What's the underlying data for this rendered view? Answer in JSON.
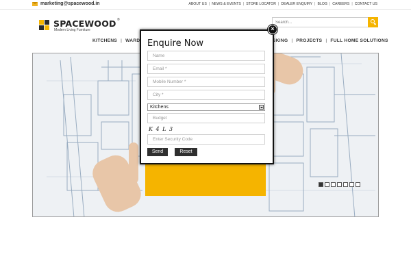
{
  "header": {
    "email": "marketing@spacewood.in",
    "links": [
      "ABOUT US",
      "NEWS & EVENTS",
      "STORE LOCATOR",
      "DEALER ENQUIRY",
      "BLOG",
      "CAREERS",
      "CONTACT US"
    ]
  },
  "logo": {
    "brand": "SPACEWOOD",
    "registered": "®",
    "tagline": "Modern Living Furniture"
  },
  "search": {
    "placeholder": "Search..."
  },
  "nav": {
    "left": [
      "KITCHENS",
      "WARD"
    ],
    "right": [
      "SKING",
      "PROJECTS",
      "FULL HOME SOLUTIONS"
    ]
  },
  "slider": {
    "slide_count": 7,
    "active_index": 0
  },
  "modal": {
    "title": "Enquire Now",
    "close_label": "×",
    "fields": {
      "name": "Name",
      "email": "Email *",
      "mobile": "Mobile Number *",
      "city": "City *",
      "category": "Kitchens",
      "budget": "Budget",
      "captcha_text": "K 4 L 3",
      "security": "Enter Security Code"
    },
    "send_label": "Send",
    "reset_label": "Reset"
  },
  "colors": {
    "accent": "#f5b400",
    "dark": "#2f2f2f"
  }
}
